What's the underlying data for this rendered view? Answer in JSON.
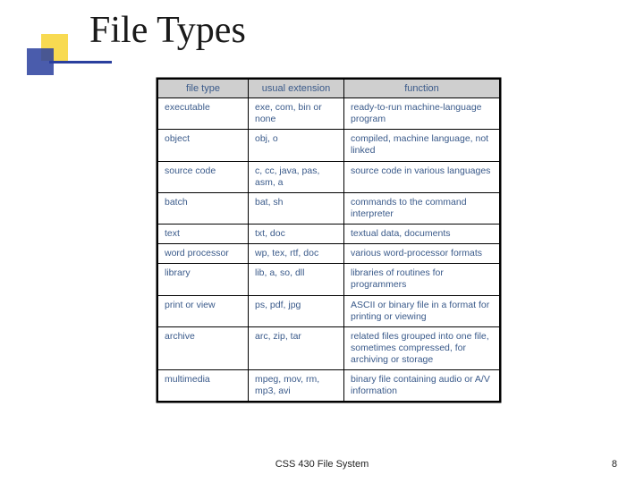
{
  "title": "File Types",
  "footer": {
    "center": "CSS 430 File System",
    "page": "8"
  },
  "table": {
    "headers": [
      "file type",
      "usual extension",
      "function"
    ],
    "rows": [
      {
        "type": "executable",
        "ext": "exe, com, bin or none",
        "func": "ready-to-run machine-language program"
      },
      {
        "type": "object",
        "ext": "obj, o",
        "func": "compiled, machine language, not linked"
      },
      {
        "type": "source code",
        "ext": "c, cc, java, pas, asm, a",
        "func": "source code in various languages"
      },
      {
        "type": "batch",
        "ext": "bat, sh",
        "func": "commands to the command interpreter"
      },
      {
        "type": "text",
        "ext": "txt, doc",
        "func": "textual data, documents"
      },
      {
        "type": "word processor",
        "ext": "wp, tex, rtf, doc",
        "func": "various word-processor formats"
      },
      {
        "type": "library",
        "ext": "lib, a, so, dll",
        "func": "libraries of routines for programmers"
      },
      {
        "type": "print or view",
        "ext": "ps, pdf, jpg",
        "func": "ASCII or binary file in a format for printing or viewing"
      },
      {
        "type": "archive",
        "ext": "arc, zip, tar",
        "func": "related files grouped into one file, sometimes compressed, for archiving or storage"
      },
      {
        "type": "multimedia",
        "ext": "mpeg, mov, rm, mp3, avi",
        "func": "binary file containing audio or A/V information"
      }
    ]
  }
}
